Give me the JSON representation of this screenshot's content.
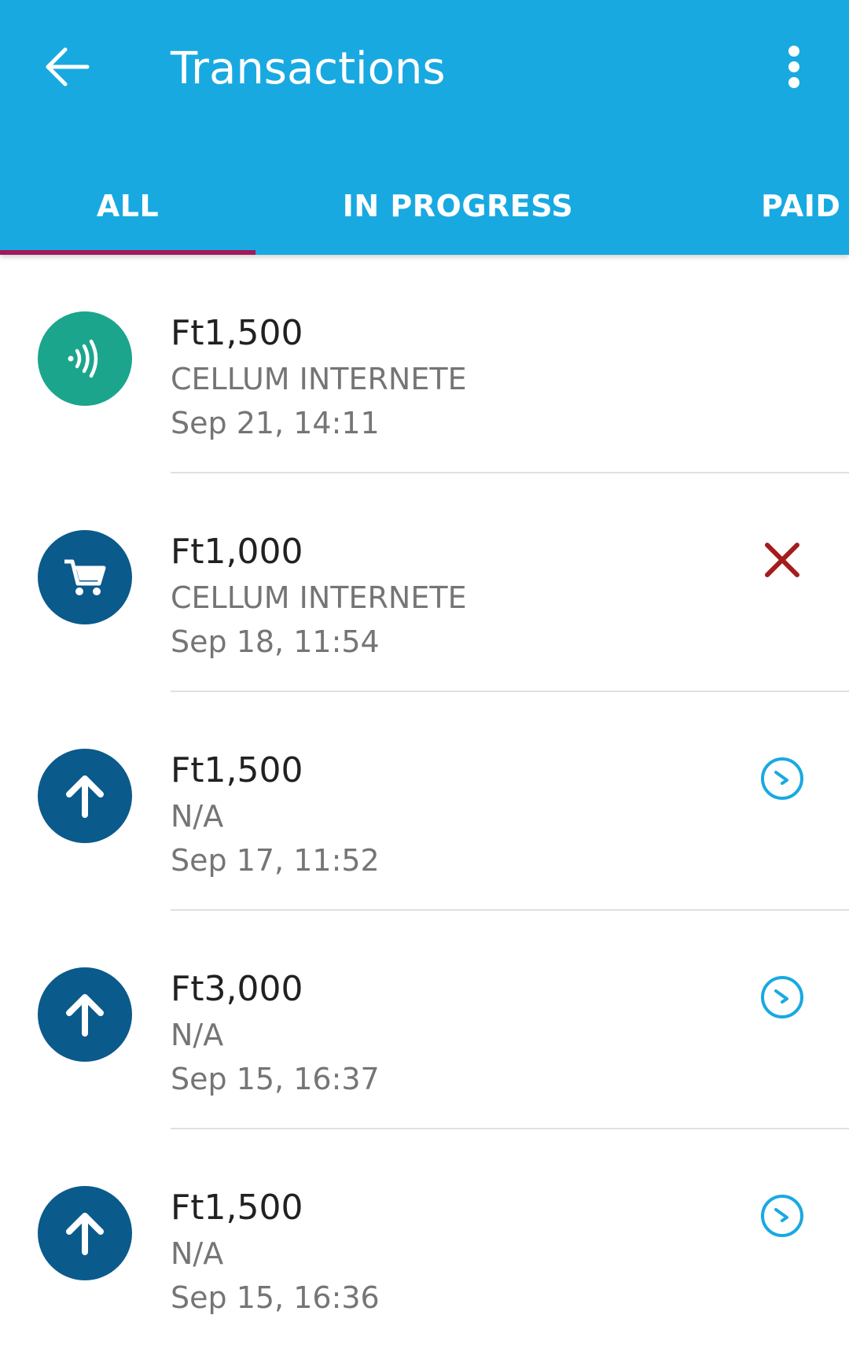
{
  "toolbar": {
    "title": "Transactions",
    "back_icon": "arrow-back-icon",
    "more_icon": "more-vert-icon"
  },
  "tabs": [
    {
      "label": "ALL",
      "selected": true
    },
    {
      "label": "IN PROGRESS",
      "selected": false
    },
    {
      "label": "PAID",
      "selected": false
    }
  ],
  "colors": {
    "appbar": "#18a9e1",
    "tab_indicator": "#a0195a",
    "nfc_avatar": "#1ba58c",
    "navy_avatar": "#0a5a8c",
    "failed": "#a51c1c",
    "pending": "#18a9e1"
  },
  "transactions": [
    {
      "amount": "Ft1,500",
      "merchant": "CELLUM INTERNETE",
      "date": "Sep 21, 14:11",
      "type_icon": "contactless-icon",
      "status": "none"
    },
    {
      "amount": "Ft1,000",
      "merchant": "CELLUM INTERNETE",
      "date": "Sep 18, 11:54",
      "type_icon": "shopping-cart-icon",
      "status": "failed",
      "status_icon": "close-icon"
    },
    {
      "amount": "Ft1,500",
      "merchant": "N/A",
      "date": "Sep 17, 11:52",
      "type_icon": "arrow-up-icon",
      "status": "pending",
      "status_icon": "clock-icon"
    },
    {
      "amount": "Ft3,000",
      "merchant": "N/A",
      "date": "Sep 15, 16:37",
      "type_icon": "arrow-up-icon",
      "status": "pending",
      "status_icon": "clock-icon"
    },
    {
      "amount": "Ft1,500",
      "merchant": "N/A",
      "date": "Sep 15, 16:36",
      "type_icon": "arrow-up-icon",
      "status": "pending",
      "status_icon": "clock-icon"
    }
  ]
}
